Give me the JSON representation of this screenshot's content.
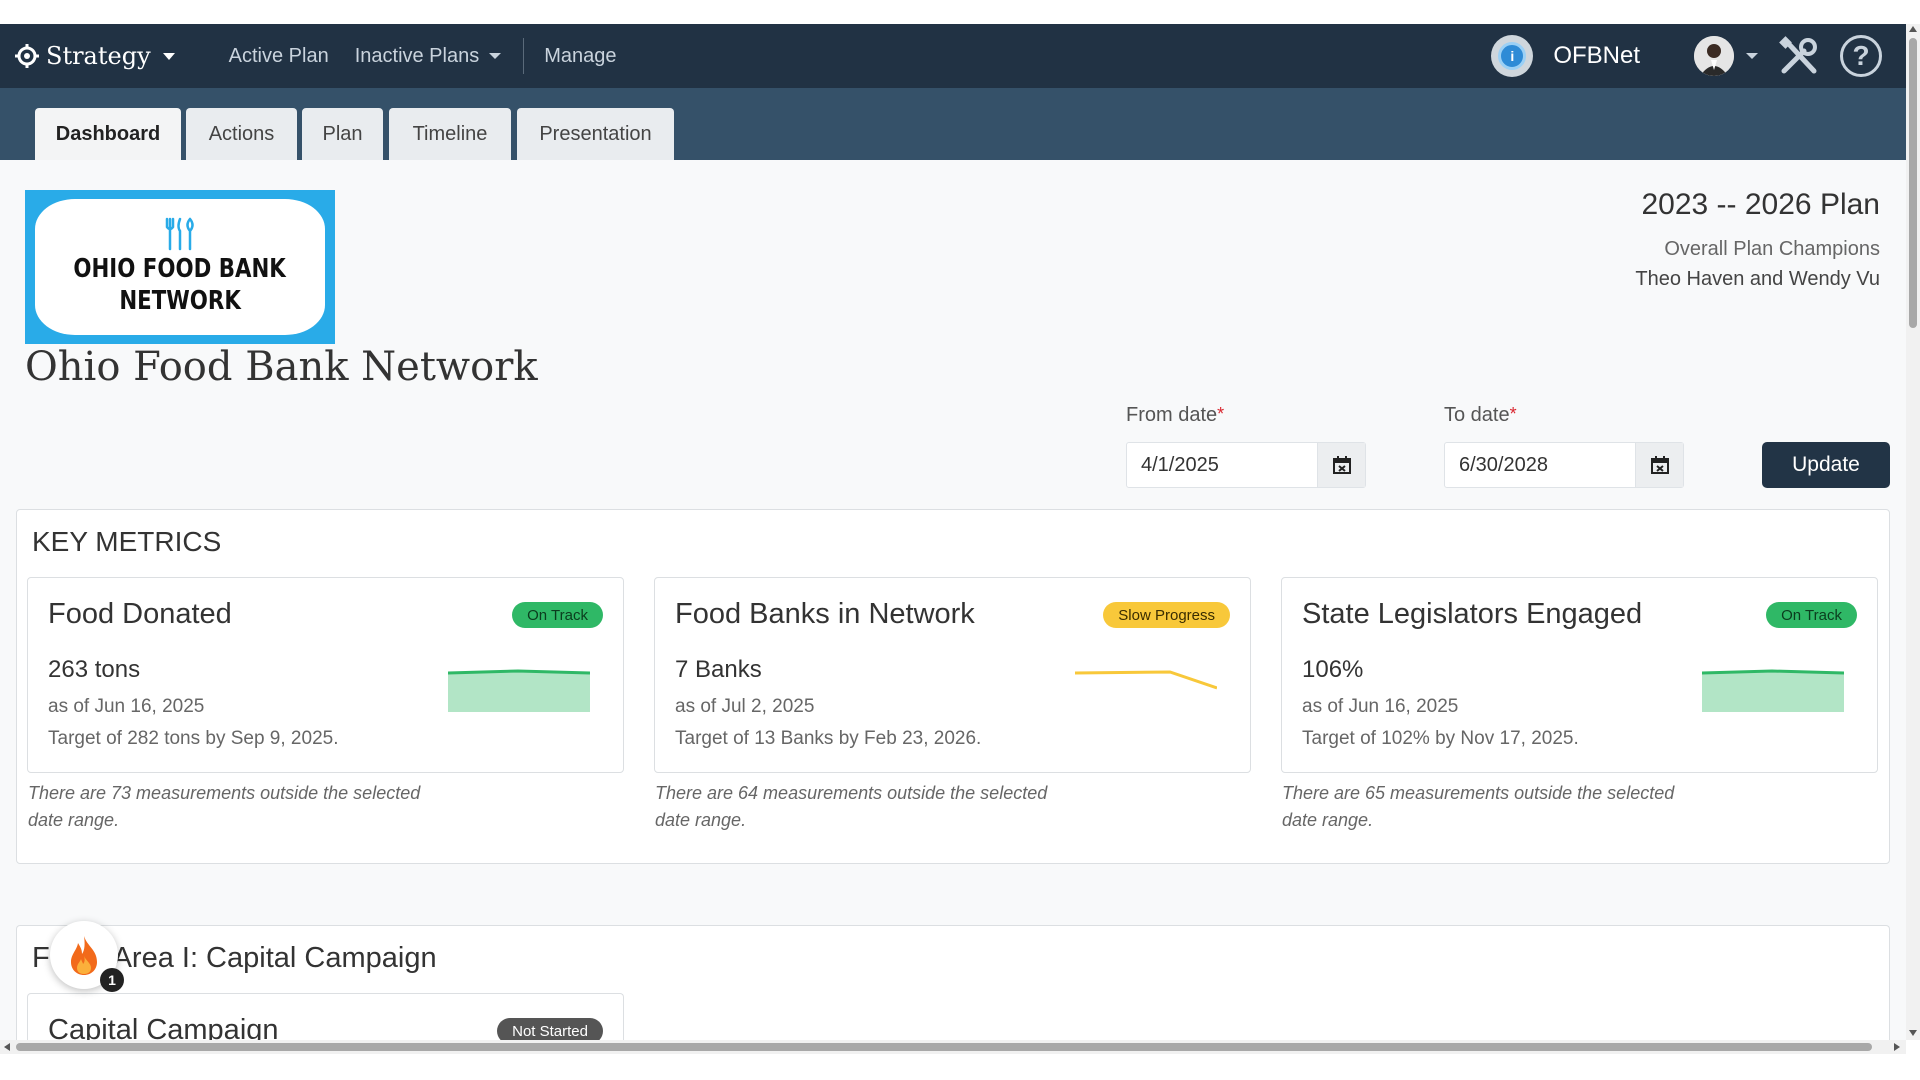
{
  "nav": {
    "brand": "Strategy",
    "active_plan": "Active Plan",
    "inactive_plans": "Inactive Plans",
    "manage": "Manage",
    "org_short": "OFBNet"
  },
  "tabs": [
    {
      "label": "Dashboard"
    },
    {
      "label": "Actions"
    },
    {
      "label": "Plan"
    },
    {
      "label": "Timeline"
    },
    {
      "label": "Presentation"
    }
  ],
  "org": {
    "logo_line1": "OHIO FOOD BANK",
    "logo_line2": "NETWORK",
    "name": "Ohio Food Bank Network"
  },
  "plan": {
    "title": "2023 -- 2026 Plan",
    "champions_label": "Overall Plan Champions",
    "champions": "Theo Haven and Wendy Vu"
  },
  "dates": {
    "from_label": "From date",
    "to_label": "To date",
    "required_mark": "*",
    "from_value": "4/1/2025",
    "to_value": "6/30/2028",
    "update_label": "Update"
  },
  "key_metrics": {
    "title": "KEY METRICS",
    "cards": [
      {
        "name": "Food Donated",
        "status": "On Track",
        "value": "263 tons",
        "as_of": "as of Jun 16, 2025",
        "target": "Target of 282 tons by Sep 9, 2025.",
        "note": "There are 73 measurements outside the selected date range."
      },
      {
        "name": "Food Banks in Network",
        "status": "Slow Progress",
        "value": "7 Banks",
        "as_of": "as of Jul 2, 2025",
        "target": "Target of 13 Banks by Feb 23, 2026.",
        "note": "There are 64 measurements outside the selected date range."
      },
      {
        "name": "State Legislators Engaged",
        "status": "On Track",
        "value": "106%",
        "as_of": "as of Jun 16, 2025",
        "target": "Target of 102% by Nov 17, 2025.",
        "note": "There are 65 measurements outside the selected date range."
      }
    ]
  },
  "focus_area": {
    "title": "Focus Area I: Capital Campaign",
    "title_visible": "F        Area I: Capital Campaign",
    "card_name": "Capital Campaign",
    "card_status": "Not Started"
  },
  "notifications": {
    "count": "1"
  },
  "colors": {
    "navbar": "#213244",
    "tabbar": "#355169",
    "on_track": "#2fb866",
    "slow_progress": "#f8c83a",
    "not_started": "#555555",
    "update_button": "#223446",
    "logo_blue": "#29abe8"
  }
}
